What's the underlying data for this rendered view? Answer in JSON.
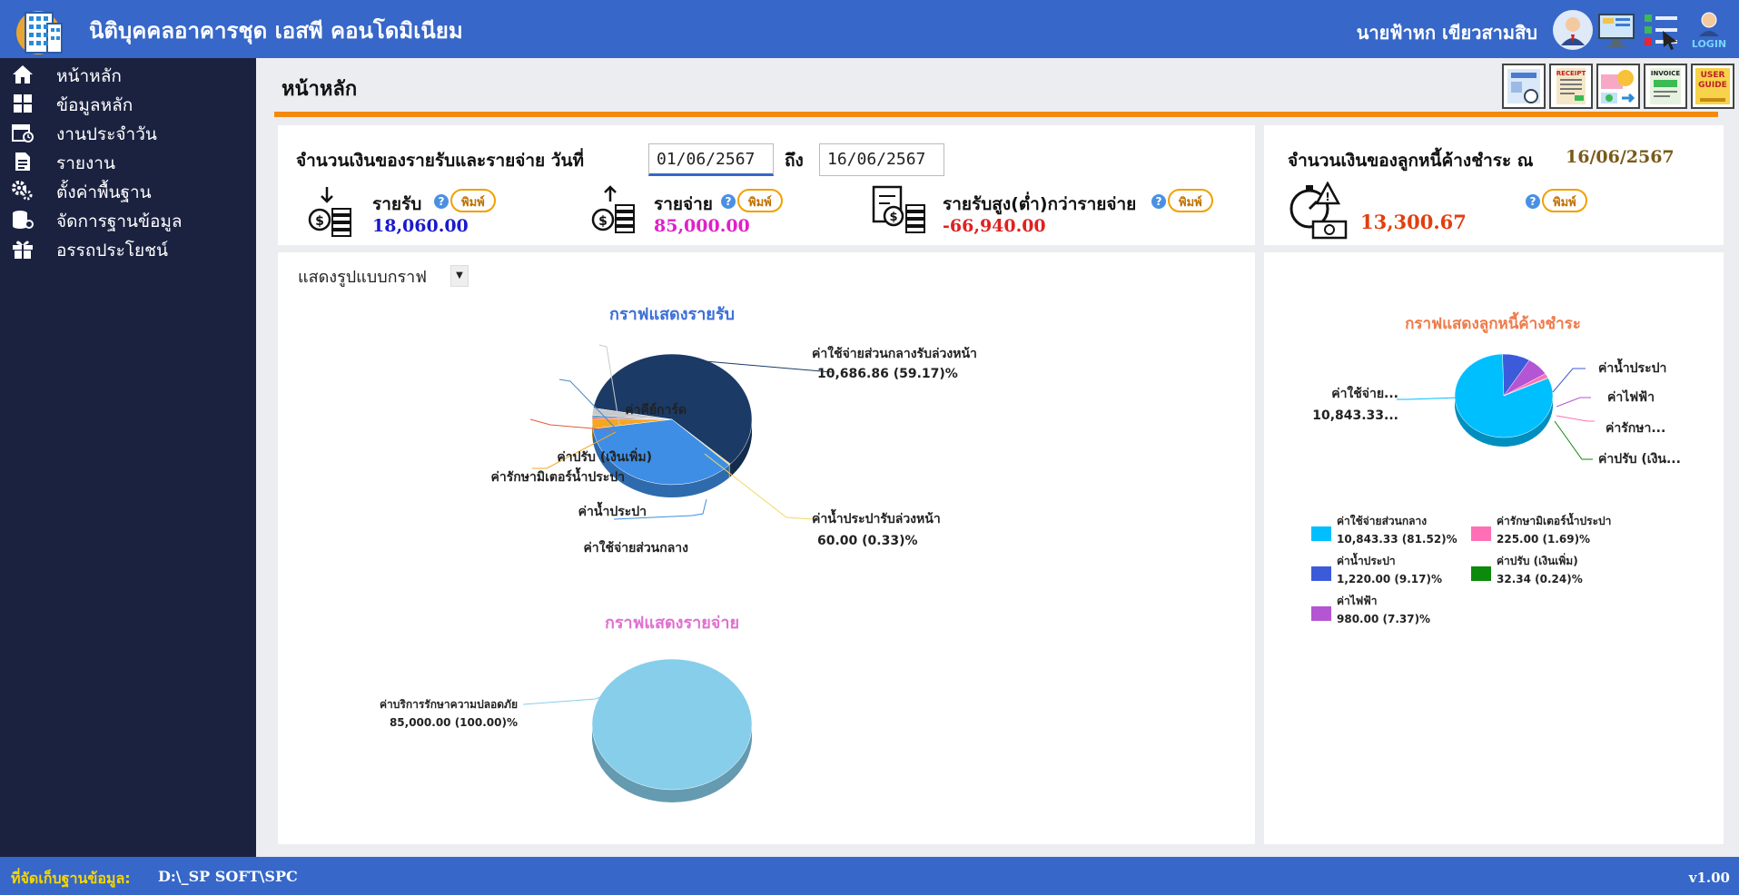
{
  "app": {
    "title": "นิติบุคคลอาคารชุด เอสพี คอนโดมิเนียม",
    "user_name": "นายฟ้าหก เขียวสามสิบ"
  },
  "sidebar": {
    "items": [
      {
        "label": "หน้าหลัก",
        "icon": "home-icon"
      },
      {
        "label": "ข้อมูลหลัก",
        "icon": "grid-icon"
      },
      {
        "label": "งานประจำวัน",
        "icon": "calendar-icon"
      },
      {
        "label": "รายงาน",
        "icon": "document-icon"
      },
      {
        "label": "ตั้งค่าพื้นฐาน",
        "icon": "gears-icon"
      },
      {
        "label": "จัดการฐานข้อมูล",
        "icon": "database-icon"
      },
      {
        "label": "อรรถประโยชน์",
        "icon": "gift-icon"
      }
    ]
  },
  "page": {
    "title": "หน้าหลัก",
    "tool_buttons": [
      "RECEIPT",
      "INVOICE",
      "USER GUIDE"
    ]
  },
  "summary": {
    "heading": "จำนวนเงินของรายรับและรายจ่าย วันที่",
    "date_from": "01/06/2567",
    "to_label": "ถึง",
    "date_to": "16/06/2567",
    "print_label": "พิมพ์",
    "income": {
      "label": "รายรับ",
      "value": "18,060.00"
    },
    "expense": {
      "label": "รายจ่าย",
      "value": "85,000.00"
    },
    "diff": {
      "label": "รายรับสูง(ต่ำ)กว่ารายจ่าย",
      "value": "-66,940.00"
    }
  },
  "debtor": {
    "heading": "จำนวนเงินของลูกหนี้ค้างชำระ ณ",
    "date": "16/06/2567",
    "value": "13,300.67",
    "print_label": "พิมพ์"
  },
  "chart_select": {
    "label": "แสดงรูปแบบกราฟ"
  },
  "footer": {
    "db_label": "ที่จัดเก็บฐานข้อมูล:",
    "db_path": "D:\\_SP SOFT\\SPC",
    "version": "v1.00"
  },
  "colors": {
    "topbar": "#3667c9",
    "sidebar": "#1b2240",
    "accent": "#f38a10",
    "income": "#1a1acd",
    "expense": "#e020c8",
    "diff": "#e02020",
    "debtor": "#e04010"
  },
  "chart_data": [
    {
      "type": "pie",
      "title": "กราฟแสดงรายรับ",
      "slices": [
        {
          "label": "ค่าใช้จ่ายส่วนกลางรับล่วงหน้า",
          "value": 10686.86,
          "percent": 59.17,
          "display": "10,686.86 (59.17)%",
          "color": "#1b3a66"
        },
        {
          "label": "ค่าน้ำประปารับล่วงหน้า",
          "value": 60.0,
          "percent": 0.33,
          "display": "60.00 (0.33)%",
          "color": "#f2d860"
        },
        {
          "label": "ค่าใช้จ่ายส่วนกลาง",
          "value": 6400,
          "percent": 35.4,
          "color": "#3e8ee6"
        },
        {
          "label": "ค่าน้ำประปา",
          "value": 420,
          "percent": 2.3,
          "color": "#f5a623"
        },
        {
          "label": "ค่ารักษามิเตอร์น้ำประปา",
          "value": 80,
          "percent": 0.4,
          "color": "#e15b3a"
        },
        {
          "label": "ค่าปรับ (เงินเพิ่ม)",
          "value": 90,
          "percent": 0.5,
          "color": "#4a88c2"
        },
        {
          "label": "ค่าคีย์การ์ด",
          "value": 320,
          "percent": 1.8,
          "color": "#c9c9c9"
        }
      ]
    },
    {
      "type": "pie",
      "title": "กราฟแสดงรายจ่าย",
      "slices": [
        {
          "label": "ค่าบริการรักษาความปลอดภัย",
          "value": 85000.0,
          "percent": 100.0,
          "display": "85,000.00 (100.00)%",
          "color": "#87ceeb"
        }
      ]
    },
    {
      "type": "pie",
      "title": "กราฟแสดงลูกหนี้ค้างชำระ",
      "slice_labels": {
        "central": "ค่าใช้จ่าย...",
        "central_value": "10,843.33...",
        "water": "ค่าน้ำประปา",
        "electric": "ค่าไฟฟ้า",
        "meter": "ค่ารักษา...",
        "fine": "ค่าปรับ (เงิน..."
      },
      "slices": [
        {
          "label": "ค่าใช้จ่ายส่วนกลาง",
          "value": 10843.33,
          "percent": 81.52,
          "display": "10,843.33 (81.52)%",
          "color": "#00bfff"
        },
        {
          "label": "ค่าน้ำประปา",
          "value": 1220.0,
          "percent": 9.17,
          "display": "1,220.00 (9.17)%",
          "color": "#3b5bdb"
        },
        {
          "label": "ค่าไฟฟ้า",
          "value": 980.0,
          "percent": 7.37,
          "display": "980.00 (7.37)%",
          "color": "#b455d4"
        },
        {
          "label": "ค่ารักษามิเตอร์น้ำประปา",
          "value": 225.0,
          "percent": 1.69,
          "display": "225.00 (1.69)%",
          "color": "#ff6fb5"
        },
        {
          "label": "ค่าปรับ (เงินเพิ่ม)",
          "value": 32.34,
          "percent": 0.24,
          "display": "32.34 (0.24)%",
          "color": "#0b8a0b"
        }
      ]
    }
  ]
}
